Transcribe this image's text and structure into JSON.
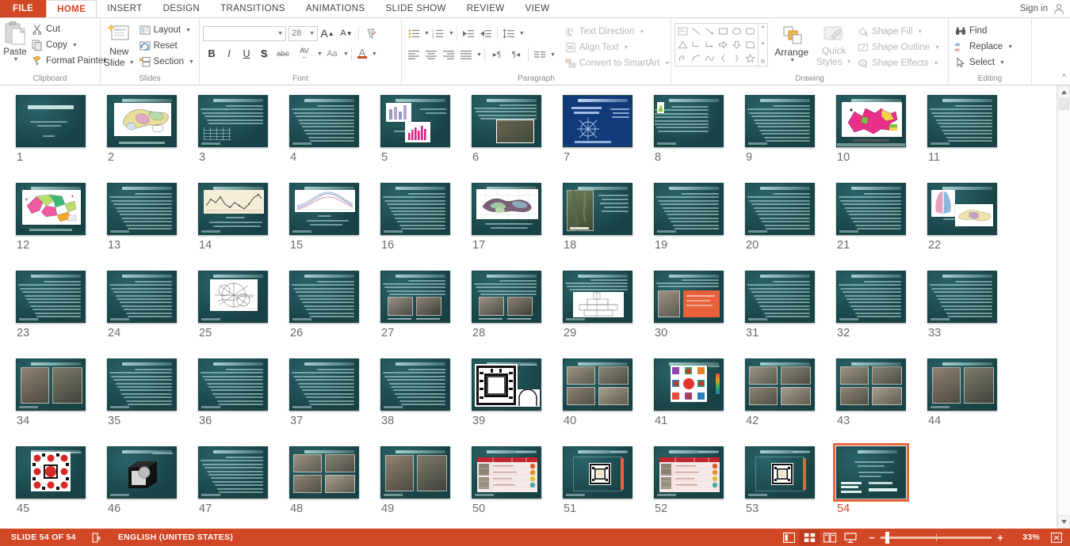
{
  "app": {
    "signin_label": "Sign in",
    "accent_color": "#d24726",
    "selection_color": "#e8663c",
    "slide_bg_color": "#1d4f52"
  },
  "tabs": [
    {
      "label": "FILE",
      "active": false,
      "file": true
    },
    {
      "label": "HOME",
      "active": true
    },
    {
      "label": "INSERT",
      "active": false
    },
    {
      "label": "DESIGN",
      "active": false
    },
    {
      "label": "TRANSITIONS",
      "active": false
    },
    {
      "label": "ANIMATIONS",
      "active": false
    },
    {
      "label": "SLIDE SHOW",
      "active": false
    },
    {
      "label": "REVIEW",
      "active": false
    },
    {
      "label": "VIEW",
      "active": false
    }
  ],
  "ribbon": {
    "clipboard": {
      "label": "Clipboard",
      "paste": "Paste",
      "cut": "Cut",
      "copy": "Copy",
      "format_painter": "Format Painter"
    },
    "slides": {
      "label": "Slides",
      "new_slide": "New\nSlide",
      "new_slide_line1": "New",
      "new_slide_line2": "Slide",
      "layout": "Layout",
      "reset": "Reset",
      "section": "Section"
    },
    "font": {
      "label": "Font",
      "font_name_value": "",
      "font_name_placeholder": "",
      "font_size_value": "28",
      "grow_font": "A",
      "shrink_font": "A",
      "clear_formatting": "clear-formatting",
      "bold": "B",
      "italic": "I",
      "underline": "U",
      "shadow": "S",
      "strikethrough": "abc",
      "character_spacing": "AV",
      "change_case": "Aa",
      "font_color": "A"
    },
    "paragraph": {
      "label": "Paragraph",
      "text_direction": "Text Direction",
      "align_text": "Align Text",
      "convert_to_smartart": "Convert to SmartArt"
    },
    "drawing": {
      "label": "Drawing",
      "arrange": "Arrange",
      "quick_styles_line1": "Quick",
      "quick_styles_line2": "Styles",
      "shape_fill": "Shape Fill",
      "shape_outline": "Shape Outline",
      "shape_effects": "Shape Effects"
    },
    "editing": {
      "label": "Editing",
      "find": "Find",
      "replace": "Replace",
      "select": "Select"
    }
  },
  "status": {
    "slide_counter": "SLIDE 54 OF 54",
    "language": "ENGLISH (UNITED STATES)",
    "zoom_level": "33%",
    "zoom_minus": "−",
    "zoom_plus": "+"
  },
  "slides": {
    "total": 54,
    "selected": 54,
    "columns": 11,
    "items": [
      {
        "n": "1",
        "kind": "title"
      },
      {
        "n": "2",
        "kind": "map-color"
      },
      {
        "n": "3",
        "kind": "text-table"
      },
      {
        "n": "4",
        "kind": "text"
      },
      {
        "n": "5",
        "kind": "two-charts"
      },
      {
        "n": "6",
        "kind": "text-photo"
      },
      {
        "n": "7",
        "kind": "blue-diagram"
      },
      {
        "n": "8",
        "kind": "text-smallimg"
      },
      {
        "n": "9",
        "kind": "text"
      },
      {
        "n": "10",
        "kind": "map-magenta"
      },
      {
        "n": "11",
        "kind": "text"
      },
      {
        "n": "12",
        "kind": "map-multicolor"
      },
      {
        "n": "13",
        "kind": "text"
      },
      {
        "n": "14",
        "kind": "line-chart"
      },
      {
        "n": "15",
        "kind": "curve-chart"
      },
      {
        "n": "16",
        "kind": "text"
      },
      {
        "n": "17",
        "kind": "map-topo"
      },
      {
        "n": "18",
        "kind": "satellite"
      },
      {
        "n": "19",
        "kind": "text"
      },
      {
        "n": "20",
        "kind": "text"
      },
      {
        "n": "21",
        "kind": "text"
      },
      {
        "n": "22",
        "kind": "pyramid-map"
      },
      {
        "n": "23",
        "kind": "text"
      },
      {
        "n": "24",
        "kind": "text"
      },
      {
        "n": "25",
        "kind": "sketch"
      },
      {
        "n": "26",
        "kind": "text"
      },
      {
        "n": "27",
        "kind": "photo-pair"
      },
      {
        "n": "28",
        "kind": "photo-pair"
      },
      {
        "n": "29",
        "kind": "plan-white"
      },
      {
        "n": "30",
        "kind": "orange-panel"
      },
      {
        "n": "31",
        "kind": "text"
      },
      {
        "n": "32",
        "kind": "text"
      },
      {
        "n": "33",
        "kind": "text"
      },
      {
        "n": "34",
        "kind": "photo-wide"
      },
      {
        "n": "35",
        "kind": "text"
      },
      {
        "n": "36",
        "kind": "text"
      },
      {
        "n": "37",
        "kind": "text"
      },
      {
        "n": "38",
        "kind": "text"
      },
      {
        "n": "39",
        "kind": "floorplan"
      },
      {
        "n": "40",
        "kind": "photo-grid"
      },
      {
        "n": "41",
        "kind": "pattern"
      },
      {
        "n": "42",
        "kind": "photo-grid"
      },
      {
        "n": "43",
        "kind": "photo-grid"
      },
      {
        "n": "44",
        "kind": "photo-wide"
      },
      {
        "n": "45",
        "kind": "pattern-red"
      },
      {
        "n": "46",
        "kind": "object3d"
      },
      {
        "n": "47",
        "kind": "text"
      },
      {
        "n": "48",
        "kind": "photo-grid"
      },
      {
        "n": "49",
        "kind": "photo-wide"
      },
      {
        "n": "50",
        "kind": "red-table"
      },
      {
        "n": "51",
        "kind": "plan-redbar"
      },
      {
        "n": "52",
        "kind": "red-table"
      },
      {
        "n": "53",
        "kind": "plan-redbar"
      },
      {
        "n": "54",
        "kind": "summary",
        "selected": true
      }
    ]
  }
}
